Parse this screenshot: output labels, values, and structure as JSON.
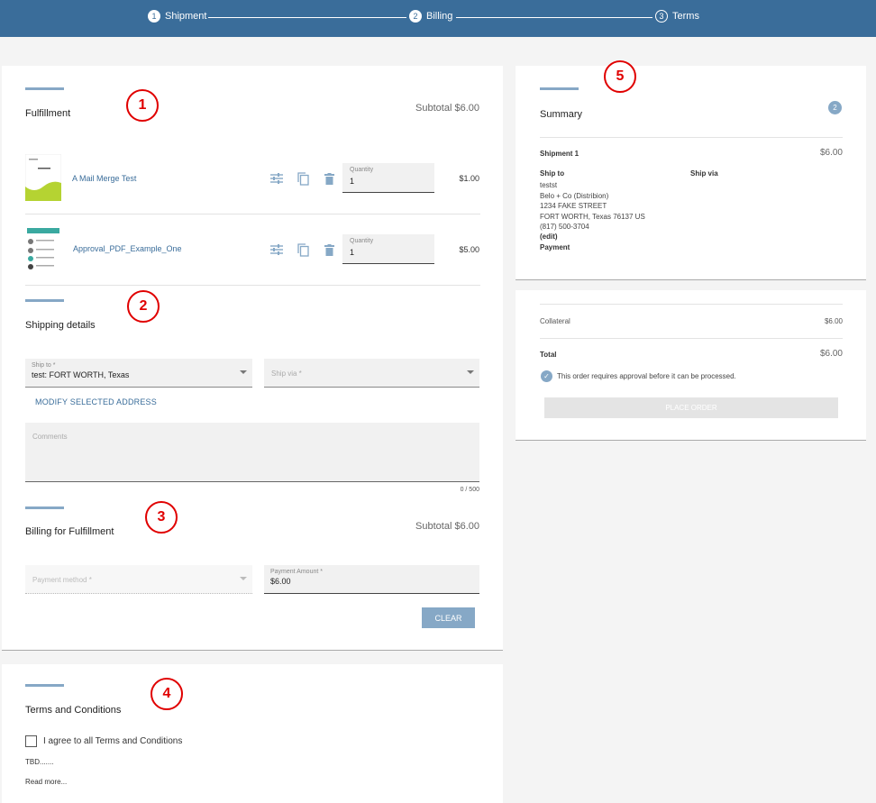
{
  "steps": [
    {
      "num": "1",
      "label": "Shipment"
    },
    {
      "num": "2",
      "label": "Billing"
    },
    {
      "num": "3",
      "label": "Terms"
    }
  ],
  "fulfillment": {
    "title": "Fulfillment",
    "subtotal": "Subtotal $6.00",
    "items": [
      {
        "name": "A Mail Merge Test",
        "qty_label": "Quantity",
        "qty": "1",
        "price": "$1.00"
      },
      {
        "name": "Approval_PDF_Example_One",
        "qty_label": "Quantity",
        "qty": "1",
        "price": "$5.00"
      }
    ]
  },
  "shipping": {
    "title": "Shipping details",
    "ship_to_label": "Ship to *",
    "ship_to_value": "test: FORT WORTH, Texas",
    "ship_via_placeholder": "Ship via *",
    "modify_link": "MODIFY SELECTED ADDRESS",
    "comments_placeholder": "Comments",
    "counter": "0 / 500"
  },
  "billing": {
    "title": "Billing for Fulfillment",
    "subtotal": "Subtotal $6.00",
    "payment_method_placeholder": "Payment method *",
    "payment_amount_label": "Payment Amount *",
    "payment_amount_value": "$6.00",
    "clear_label": "CLEAR"
  },
  "terms": {
    "title": "Terms and Conditions",
    "agree_label": "I agree to all Terms and Conditions",
    "body": "TBD.......",
    "read_more": "Read more..."
  },
  "summary": {
    "title": "Summary",
    "badge": "2",
    "shipment_label": "Shipment 1",
    "shipment_amount": "$6.00",
    "ship_to_label": "Ship to",
    "ship_via_label": "Ship via",
    "address_lines": [
      "testst",
      "Belo + Co (Distribion)",
      "1234 FAKE STREET",
      "FORT WORTH, Texas 76137 US",
      "(817) 500-3704"
    ],
    "edit_link": "(edit)",
    "payment_label": "Payment"
  },
  "totals": {
    "collateral_label": "Collateral",
    "collateral_amount": "$6.00",
    "total_label": "Total",
    "total_amount": "$6.00",
    "approval_note": "This order requires approval before it can be processed.",
    "place_order_label": "PLACE ORDER"
  },
  "callouts": [
    "1",
    "2",
    "3",
    "4",
    "5"
  ],
  "colors": {
    "brand": "#3a6d9a",
    "accent": "#86a8c6",
    "callout": "#e00000"
  }
}
